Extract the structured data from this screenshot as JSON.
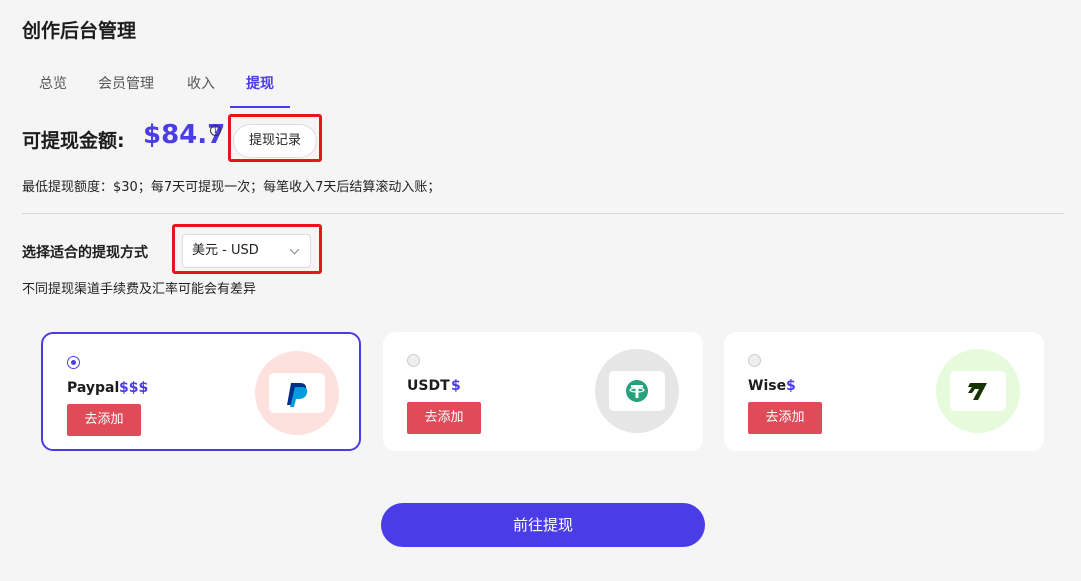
{
  "header": {
    "title": "创作后台管理"
  },
  "tabs": [
    {
      "label": "总览",
      "active": false
    },
    {
      "label": "会员管理",
      "active": false
    },
    {
      "label": "收入",
      "active": false
    },
    {
      "label": "提现",
      "active": true
    }
  ],
  "balance": {
    "label": "可提现金额:",
    "amount": "$84.7",
    "info_icon": "info-icon",
    "record_button": "提现记录"
  },
  "rules": "最低提现额度：$30；每7天可提现一次；每笔收入7天后结算滚动入账；",
  "method": {
    "label": "选择适合的提现方式",
    "currency_selected": "美元 - USD",
    "note": "不同提现渠道手续费及汇率可能会有差异"
  },
  "cards": [
    {
      "name": "Paypal",
      "fee": "$$$",
      "selected": true,
      "add_label": "去添加",
      "icon": "paypal-icon",
      "circle_color": "#fde1de"
    },
    {
      "name": "USDT",
      "fee": "$",
      "selected": false,
      "add_label": "去添加",
      "icon": "tether-icon",
      "circle_color": "#e6e6e6"
    },
    {
      "name": "Wise",
      "fee": "$",
      "selected": false,
      "add_label": "去添加",
      "icon": "wise-icon",
      "circle_color": "#e6fbdc"
    }
  ],
  "submit_button": "前往提现",
  "colors": {
    "accent": "#4b3de6",
    "add_button": "#e04b5a",
    "highlight": "#e8161c"
  }
}
